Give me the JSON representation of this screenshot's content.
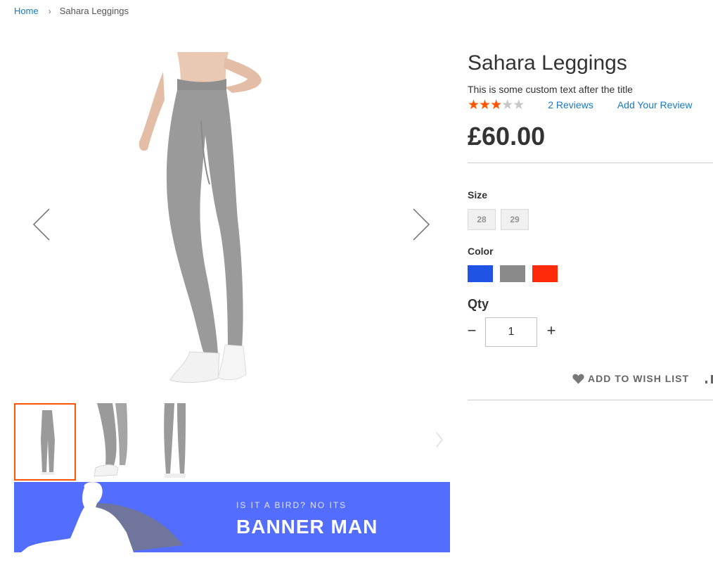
{
  "breadcrumb": {
    "home": "Home",
    "separator": "›",
    "current": "Sahara Leggings"
  },
  "product": {
    "title": "Sahara Leggings",
    "custom_text": "This is some custom text after the title",
    "rating": {
      "stars": 3,
      "max": 5
    },
    "reviews_link": "2 Reviews",
    "add_review_link": "Add Your Review",
    "price": "£60.00"
  },
  "options": {
    "size_label": "Size",
    "sizes": [
      "28",
      "29"
    ],
    "color_label": "Color",
    "colors": [
      "#1e53e5",
      "#8a8a8a",
      "#ff2a0a"
    ]
  },
  "qty": {
    "label": "Qty",
    "value": "1",
    "minus": "−",
    "plus": "+"
  },
  "actions": {
    "wishlist": "ADD TO WISH LIST"
  },
  "banner": {
    "kicker": "IS IT A BIRD? NO ITS",
    "headline": "BANNER MAN"
  },
  "theme": {
    "accent": "#ff5501",
    "link": "#1979c3",
    "banner_bg": "#536dfe",
    "legging_gray": "#9a9a9a"
  },
  "icons": [
    "chevron-left-icon",
    "chevron-right-icon",
    "heart-icon",
    "compare-icon",
    "star-icon"
  ]
}
